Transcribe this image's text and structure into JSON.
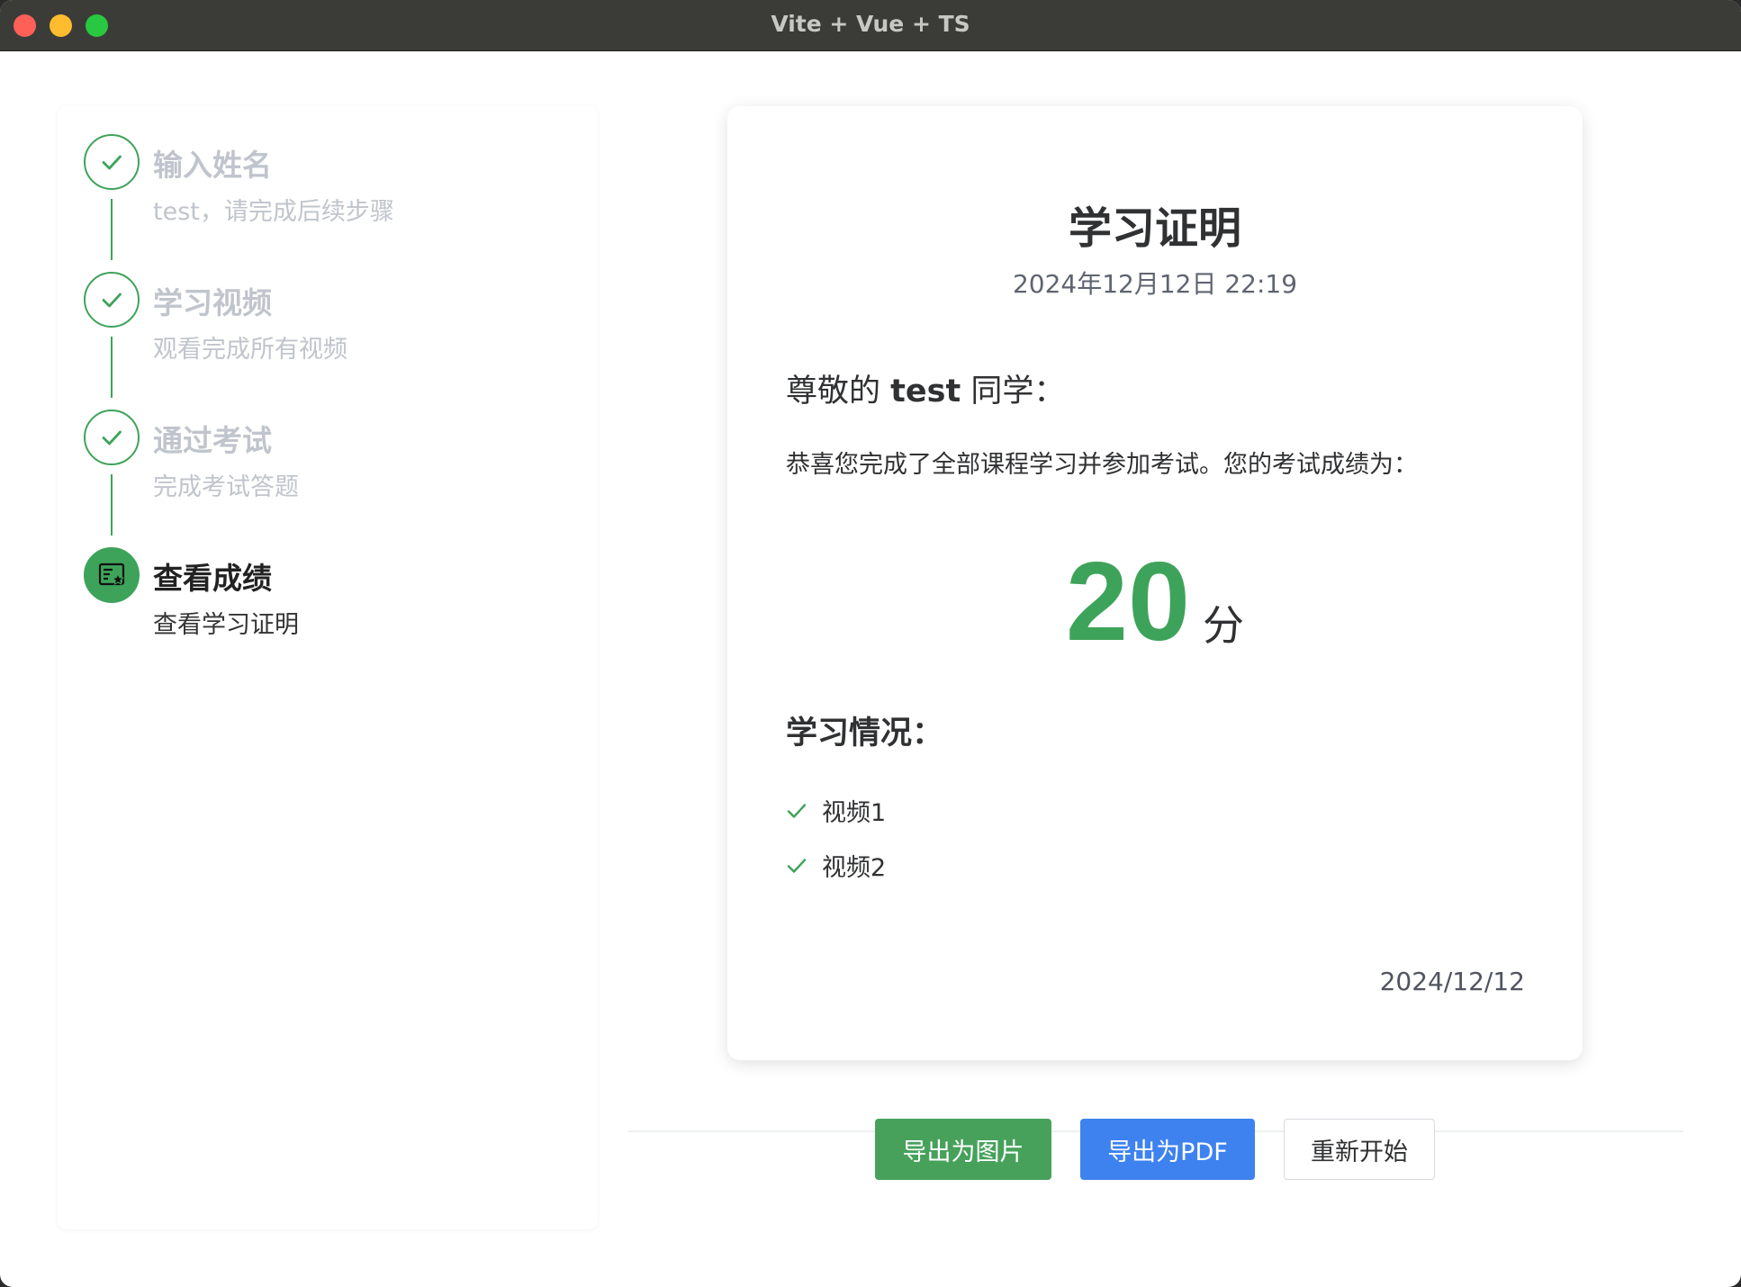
{
  "window": {
    "title": "Vite + Vue + TS"
  },
  "steps": [
    {
      "title": "输入姓名",
      "desc": "test，请完成后续步骤",
      "status": "done",
      "icon": "check-icon"
    },
    {
      "title": "学习视频",
      "desc": "观看完成所有视频",
      "status": "done",
      "icon": "check-icon"
    },
    {
      "title": "通过考试",
      "desc": "完成考试答题",
      "status": "done",
      "icon": "check-icon"
    },
    {
      "title": "查看成绩",
      "desc": "查看学习证明",
      "status": "current",
      "icon": "certificate-icon"
    }
  ],
  "certificate": {
    "title": "学习证明",
    "datetime": "2024年12月12日 22:19",
    "greeting_prefix": "尊敬的 ",
    "student_name": "test",
    "greeting_suffix": " 同学：",
    "congrats_text": "恭喜您完成了全部课程学习并参加考试。您的考试成绩为：",
    "score": "20",
    "score_unit": "分",
    "study_section_title": "学习情况：",
    "videos": [
      "视频1",
      "视频2"
    ],
    "date": "2024/12/12"
  },
  "actions": {
    "export_image": "导出为图片",
    "export_pdf": "导出为PDF",
    "restart": "重新开始"
  },
  "colors": {
    "accent_green": "#3ea35a",
    "button_green": "#47a15b",
    "button_blue": "#3e82f0"
  }
}
